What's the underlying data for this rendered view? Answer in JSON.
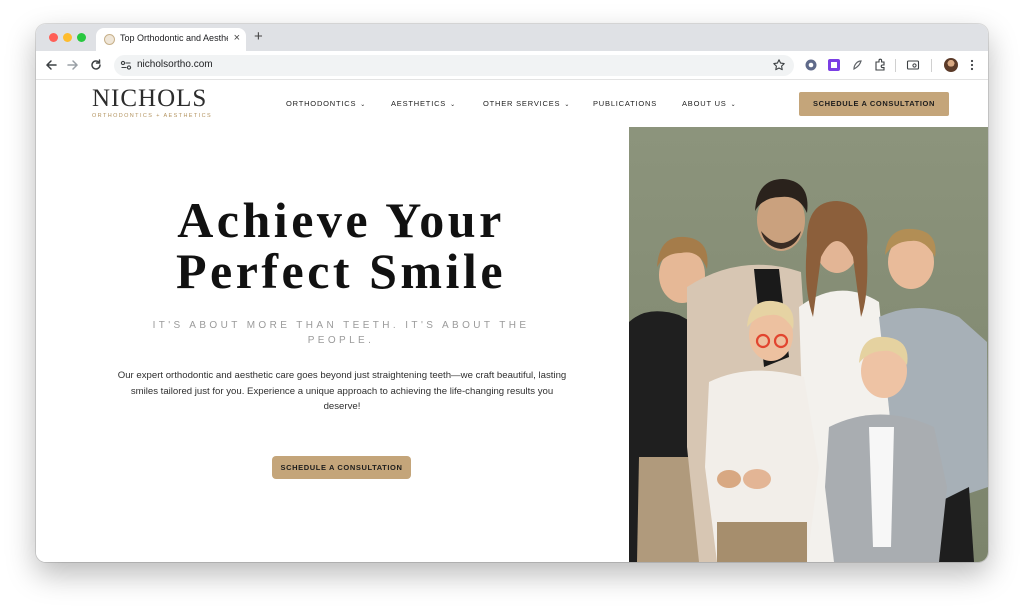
{
  "browser": {
    "tab_title": "Top Orthodontic and Aesthetic",
    "tab_close": "×",
    "new_tab": "+",
    "url": "nicholsortho.com"
  },
  "site": {
    "logo": {
      "name": "NICHOLS",
      "tagline": "ORTHODONTICS + AESTHETICS"
    },
    "nav": {
      "items": [
        {
          "label": "ORTHODONTICS",
          "caret": "⌄"
        },
        {
          "label": "AESTHETICS",
          "caret": "⌄"
        },
        {
          "label": "OTHER SERVICES",
          "caret": "⌄"
        },
        {
          "label": "PUBLICATIONS",
          "caret": ""
        },
        {
          "label": "ABOUT US",
          "caret": "⌄"
        }
      ],
      "cta_label": "SCHEDULE A CONSULTATION"
    },
    "hero": {
      "title_line1": "Achieve Your",
      "title_line2": "Perfect Smile",
      "tagline": "IT'S ABOUT MORE THAN TEETH. IT'S ABOUT THE PEOPLE.",
      "body": "Our expert orthodontic and aesthetic care goes beyond just straightening teeth—we craft beautiful, lasting smiles tailored just for you. Experience a unique approach to achieving the life-changing results you deserve!",
      "cta_label": "SCHEDULE A CONSULTATION"
    }
  },
  "colors": {
    "accent_gold": "#c4a57a",
    "logo_gold": "#b3935f",
    "photo_backdrop": "#8a9179"
  }
}
